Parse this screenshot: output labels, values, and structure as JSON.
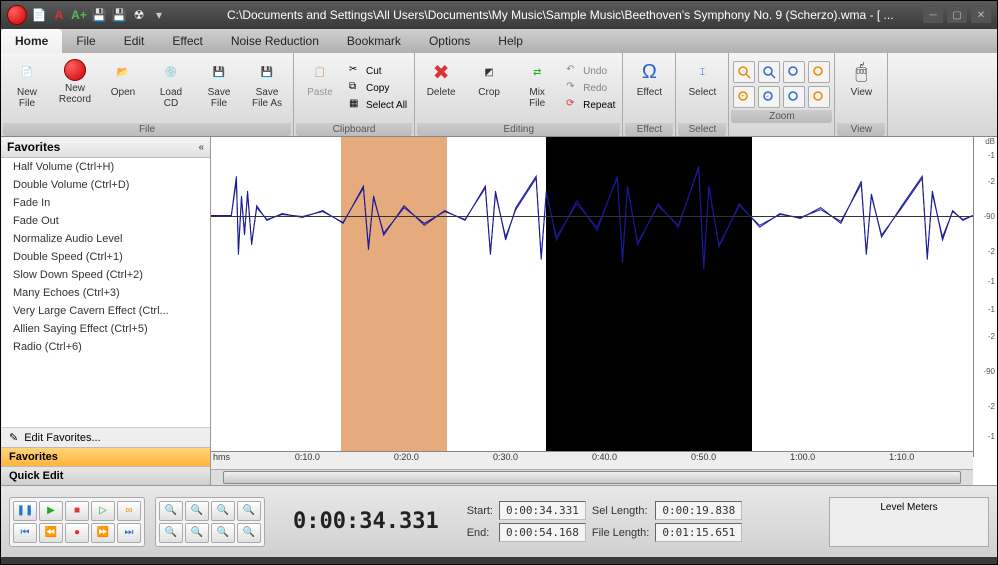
{
  "title": "C:\\Documents and Settings\\All Users\\Documents\\My Music\\Sample Music\\Beethoven's Symphony No. 9 (Scherzo).wma - [ ...",
  "menus": [
    "Home",
    "File",
    "Edit",
    "Effect",
    "Noise Reduction",
    "Bookmark",
    "Options",
    "Help"
  ],
  "ribbon": {
    "file": {
      "label": "File",
      "new_file": "New\nFile",
      "new_record": "New\nRecord",
      "open": "Open",
      "load_cd": "Load\nCD",
      "save_file": "Save\nFile",
      "save_as": "Save\nFile As"
    },
    "clipboard": {
      "label": "Clipboard",
      "paste": "Paste",
      "cut": "Cut",
      "copy": "Copy",
      "select_all": "Select All"
    },
    "editing": {
      "label": "Editing",
      "delete": "Delete",
      "crop": "Crop",
      "mix_file": "Mix\nFile",
      "undo": "Undo",
      "redo": "Redo",
      "repeat": "Repeat"
    },
    "effect": {
      "label": "Effect",
      "effect": "Effect"
    },
    "select": {
      "label": "Select",
      "select": "Select"
    },
    "zoom": {
      "label": "Zoom"
    },
    "view": {
      "label": "View",
      "view": "View"
    }
  },
  "sidebar": {
    "title": "Favorites",
    "items": [
      "Half Volume (Ctrl+H)",
      "Double Volume (Ctrl+D)",
      "Fade In",
      "Fade Out",
      "Normalize Audio Level",
      "Double Speed (Ctrl+1)",
      "Slow Down Speed (Ctrl+2)",
      "Many Echoes (Ctrl+3)",
      "Very Large Cavern Effect (Ctrl...",
      "Allien Saying Effect (Ctrl+5)",
      "Radio (Ctrl+6)"
    ],
    "edit": "Edit Favorites...",
    "sections": {
      "favorites": "Favorites",
      "quick_edit": "Quick Edit"
    }
  },
  "timeline": {
    "unit": "hms",
    "ticks": [
      "0:10.0",
      "0:20.0",
      "0:30.0",
      "0:40.0",
      "0:50.0",
      "1:00.0",
      "1:10.0"
    ]
  },
  "db_label": "dB",
  "db_ticks": [
    "-1",
    "-2",
    "-90",
    "-2",
    "-1",
    "-1",
    "-2",
    "-90",
    "-2",
    "-1"
  ],
  "transport_time": "0:00:34.331",
  "info": {
    "start_label": "Start:",
    "start": "0:00:34.331",
    "end_label": "End:",
    "end": "0:00:54.168",
    "sel_label": "Sel Length:",
    "sel": "0:00:19.838",
    "file_label": "File Length:",
    "file": "0:01:15.651"
  },
  "meters_label": "Level Meters"
}
